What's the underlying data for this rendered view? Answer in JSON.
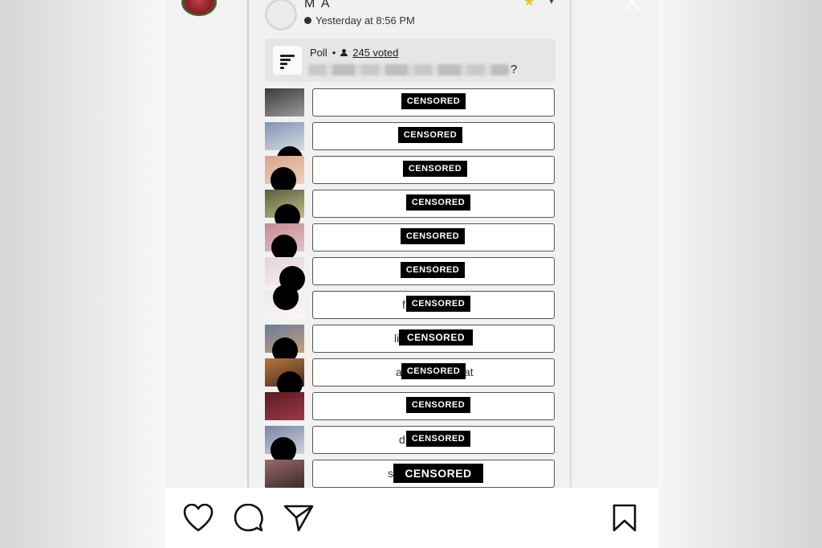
{
  "post": {
    "author": "M A",
    "timestamp": "Yesterday at 8:56 PM"
  },
  "poll": {
    "label": "Poll",
    "separator": "•",
    "votes": "245 voted",
    "question_end": "?"
  },
  "options": [
    {
      "censor": "CENSORED",
      "prefix": "",
      "suffix": ""
    },
    {
      "censor": "CENSORED",
      "prefix": "",
      "suffix": ""
    },
    {
      "censor": "CENSORED",
      "prefix": "",
      "suffix": ""
    },
    {
      "censor": "CENSORED",
      "prefix": "",
      "suffix": ""
    },
    {
      "censor": "CENSORED",
      "prefix": "",
      "suffix": ""
    },
    {
      "censor": "CENSORED",
      "prefix": "",
      "suffix": ""
    },
    {
      "censor": "CENSORED",
      "prefix": "f",
      "suffix": ""
    },
    {
      "censor": "CENSORED",
      "prefix": "li",
      "suffix": ""
    },
    {
      "censor": "CENSORED",
      "prefix": "a",
      "suffix": "at"
    },
    {
      "censor": "CENSORED",
      "prefix": "",
      "suffix": ""
    },
    {
      "censor": "CENSORED",
      "prefix": "d",
      "suffix": ""
    },
    {
      "censor": "CENSORED",
      "prefix": "s",
      "suffix": ""
    }
  ],
  "icons": {
    "like": "heart-icon",
    "comment": "comment-icon",
    "share": "send-icon",
    "save": "bookmark-icon",
    "close": "close-icon"
  }
}
